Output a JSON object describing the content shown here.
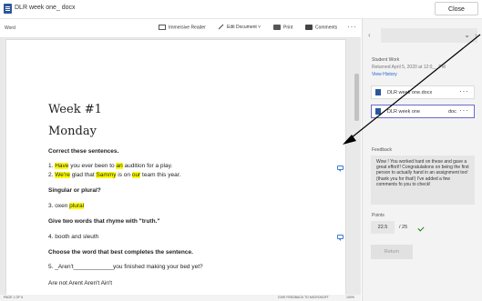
{
  "topbar": {
    "file_title": "DLR week one_            docx",
    "close_label": "Close"
  },
  "word": {
    "label": "Word",
    "toolbar": {
      "immersive_reader": "Immersive Reader",
      "edit_document": "Edit Document ˅",
      "print": "Print",
      "comments": "Comments",
      "more": "···"
    },
    "document": {
      "heading1": "Week #1",
      "heading2": "Monday",
      "section1": "Correct these sentences.",
      "s1_line1": {
        "p1": "1. ",
        "h1": "Have",
        "p2": " you ever been to ",
        "h2": "an",
        "p3": " audition for a play."
      },
      "s1_line2": {
        "p1": "2. ",
        "h1": "We're",
        "p2": " glad that ",
        "h2": "Sammy",
        "p3": " is on ",
        "h3": "our",
        "p4": " team this year."
      },
      "section2": "Singular or plural?",
      "s2_line": {
        "p1": "3. oxen ",
        "h1": "plural"
      },
      "section3": "Give two words that rhyme with \"truth.\"",
      "s3_line": "4. booth and sleuth",
      "section4": "Choose the word that best completes the sentence.",
      "s4_line": "5. _Aren't____________you finished making your bed yet?",
      "s4_options": "Are not    Arent    Aren't    Ain't"
    },
    "status": {
      "page": "PAGE 1 OF 6",
      "feedback": "GIVE FEEDBACK TO MICROSOFT",
      "zoom": "100%"
    }
  },
  "panel": {
    "student_work_label": "Student Work",
    "returned": "Returned April 5, 2020 at 12:0__ PM",
    "view_history": "View History",
    "attachments": [
      {
        "name": "DLR week one.docx",
        "ext": ""
      },
      {
        "name": "DLR week one",
        "ext": "doc"
      }
    ],
    "feedback_label": "Feedback",
    "feedback_text": "Wow             ! You worked hard on these and gave a great effort!! Congratulations on being the first person to actually hand in an assignment too! (thank you for that!)  I've added a few comments fo you to check!",
    "points_label": "Points",
    "points_value": "22.5",
    "points_total": "/ 25",
    "return_label": "Return"
  },
  "colors": {
    "highlight": "#ffff00",
    "link": "#2564cf",
    "word_blue": "#2b579a",
    "check_green": "#107c10"
  }
}
